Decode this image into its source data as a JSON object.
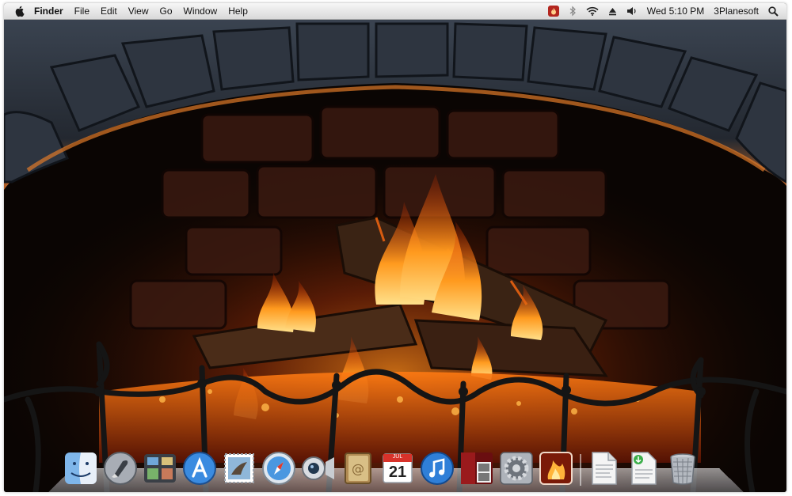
{
  "menubar": {
    "app_name": "Finder",
    "menus": [
      "File",
      "Edit",
      "View",
      "Go",
      "Window",
      "Help"
    ],
    "clock": "Wed 5:10 PM",
    "user": "3Planesoft"
  },
  "dock": {
    "calendar_month": "JUL",
    "calendar_day": "21"
  }
}
